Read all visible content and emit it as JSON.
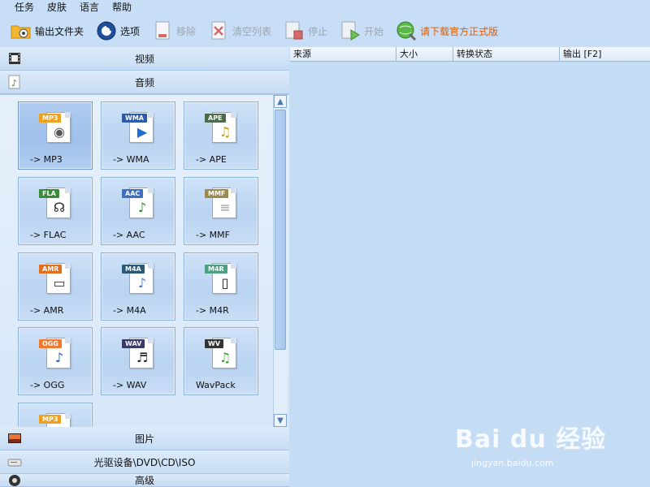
{
  "menu": [
    "任务",
    "皮肤",
    "语言",
    "帮助"
  ],
  "toolbar": {
    "output_folder": "输出文件夹",
    "options": "选项",
    "remove": "移除",
    "clear_list": "清空列表",
    "stop": "停止",
    "start": "开始",
    "download": "请下载官方正式版"
  },
  "categories": {
    "video": "视频",
    "audio": "音频",
    "picture": "图片",
    "rom": "光驱设备\\DVD\\CD\\ISO",
    "advanced": "高级"
  },
  "formats": [
    {
      "tag": "MP3",
      "label": "-> MP3",
      "tag_color": "#f0a020",
      "glyph": "◉",
      "glyph_color": "#555"
    },
    {
      "tag": "WMA",
      "label": "-> WMA",
      "tag_color": "#2e5aa8",
      "glyph": "▶",
      "glyph_color": "#1f6fd1"
    },
    {
      "tag": "APE",
      "label": "-> APE",
      "tag_color": "#4a6a4a",
      "glyph": "♫",
      "glyph_color": "#c89a10"
    },
    {
      "tag": "FLA",
      "label": "-> FLAC",
      "tag_color": "#3a8a3a",
      "glyph": "☊",
      "glyph_color": "#222"
    },
    {
      "tag": "AAC",
      "label": "-> AAC",
      "tag_color": "#3f6fc0",
      "glyph": "♪",
      "glyph_color": "#2f8a3a"
    },
    {
      "tag": "MMF",
      "label": "-> MMF",
      "tag_color": "#9a8a50",
      "glyph": "≡",
      "glyph_color": "#999"
    },
    {
      "tag": "AMR",
      "label": "-> AMR",
      "tag_color": "#e07020",
      "glyph": "▭",
      "glyph_color": "#333"
    },
    {
      "tag": "M4A",
      "label": "-> M4A",
      "tag_color": "#2a5a7a",
      "glyph": "♪",
      "glyph_color": "#4a7ac0"
    },
    {
      "tag": "M4R",
      "label": "-> M4R",
      "tag_color": "#4aa080",
      "glyph": "▯",
      "glyph_color": "#111"
    },
    {
      "tag": "OGG",
      "label": "-> OGG",
      "tag_color": "#f07830",
      "glyph": "♪",
      "glyph_color": "#2a5ab0"
    },
    {
      "tag": "WAV",
      "label": "-> WAV",
      "tag_color": "#3a3a6a",
      "glyph": "♬",
      "glyph_color": "#222"
    },
    {
      "tag": "WV",
      "label": "WavPack",
      "tag_color": "#333333",
      "glyph": "♫",
      "glyph_color": "#3aa030"
    },
    {
      "tag": "MP3",
      "label": "",
      "tag_color": "#f0a020",
      "glyph": "",
      "glyph_color": "#555"
    }
  ],
  "list_columns": [
    "来源",
    "大小",
    "转换状态",
    "输出 [F2]"
  ],
  "watermark": {
    "brand": "Bai du 经验",
    "url": "jingyan.baidu.com"
  }
}
